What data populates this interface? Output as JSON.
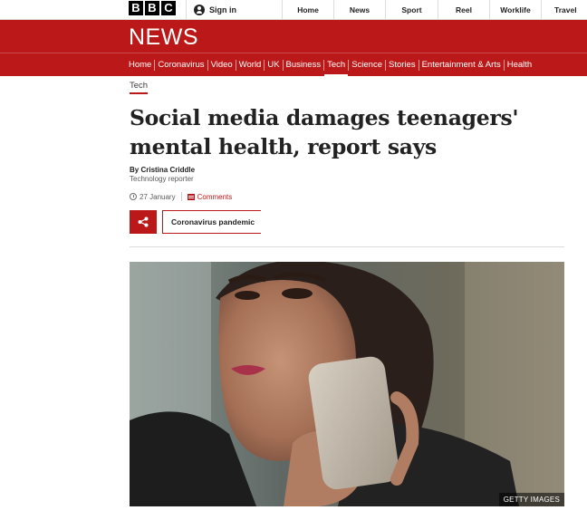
{
  "masthead": {
    "logo_letters": [
      "B",
      "B",
      "C"
    ],
    "sign_in": "Sign in",
    "nav": [
      "Home",
      "News",
      "Sport",
      "Reel",
      "Worklife",
      "Travel"
    ]
  },
  "banner": {
    "title": "NEWS"
  },
  "sections": [
    "Home",
    "Coronavirus",
    "Video",
    "World",
    "UK",
    "Business",
    "Tech",
    "Science",
    "Stories",
    "Entertainment & Arts",
    "Health"
  ],
  "active_section": "Tech",
  "article": {
    "tag": "Tech",
    "headline_line1": "Social media damages teenagers'",
    "headline_line2": "mental health, report says",
    "byline": "By Cristina Criddle",
    "role": "Technology reporter",
    "date": "27 January",
    "comments": "Comments",
    "topic": "Coronavirus pandemic",
    "image_credit": "GETTY IMAGES"
  },
  "colors": {
    "brand_red": "#bb1919",
    "text": "#222222"
  },
  "icons": {
    "share": "share-icon",
    "clock": "clock-icon",
    "comments": "comment-icon",
    "user": "user-icon"
  }
}
